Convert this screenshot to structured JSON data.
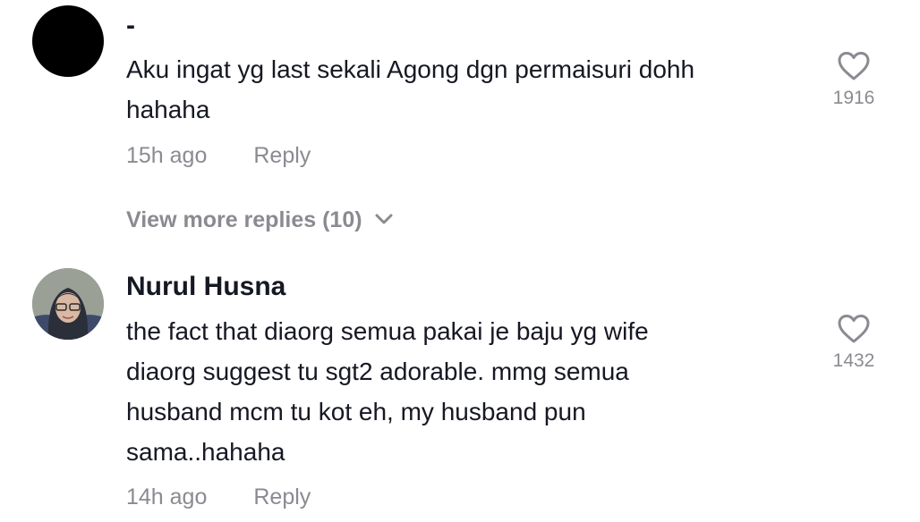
{
  "comments": [
    {
      "username": "-",
      "text_lines": [
        "Aku ingat yg last sekali Agong dgn permaisuri dohh",
        "hahaha"
      ],
      "time": "15h ago",
      "reply_label": "Reply",
      "likes": "1916"
    },
    {
      "username": "Nurul Husna",
      "text_lines": [
        "the fact that diaorg semua pakai je baju yg wife",
        "diaorg suggest tu sgt2 adorable. mmg semua",
        "husband mcm tu kot eh, my husband pun",
        "sama..hahaha"
      ],
      "time": "14h ago",
      "reply_label": "Reply",
      "likes": "1432"
    }
  ],
  "view_more_replies": "View more replies (10)"
}
